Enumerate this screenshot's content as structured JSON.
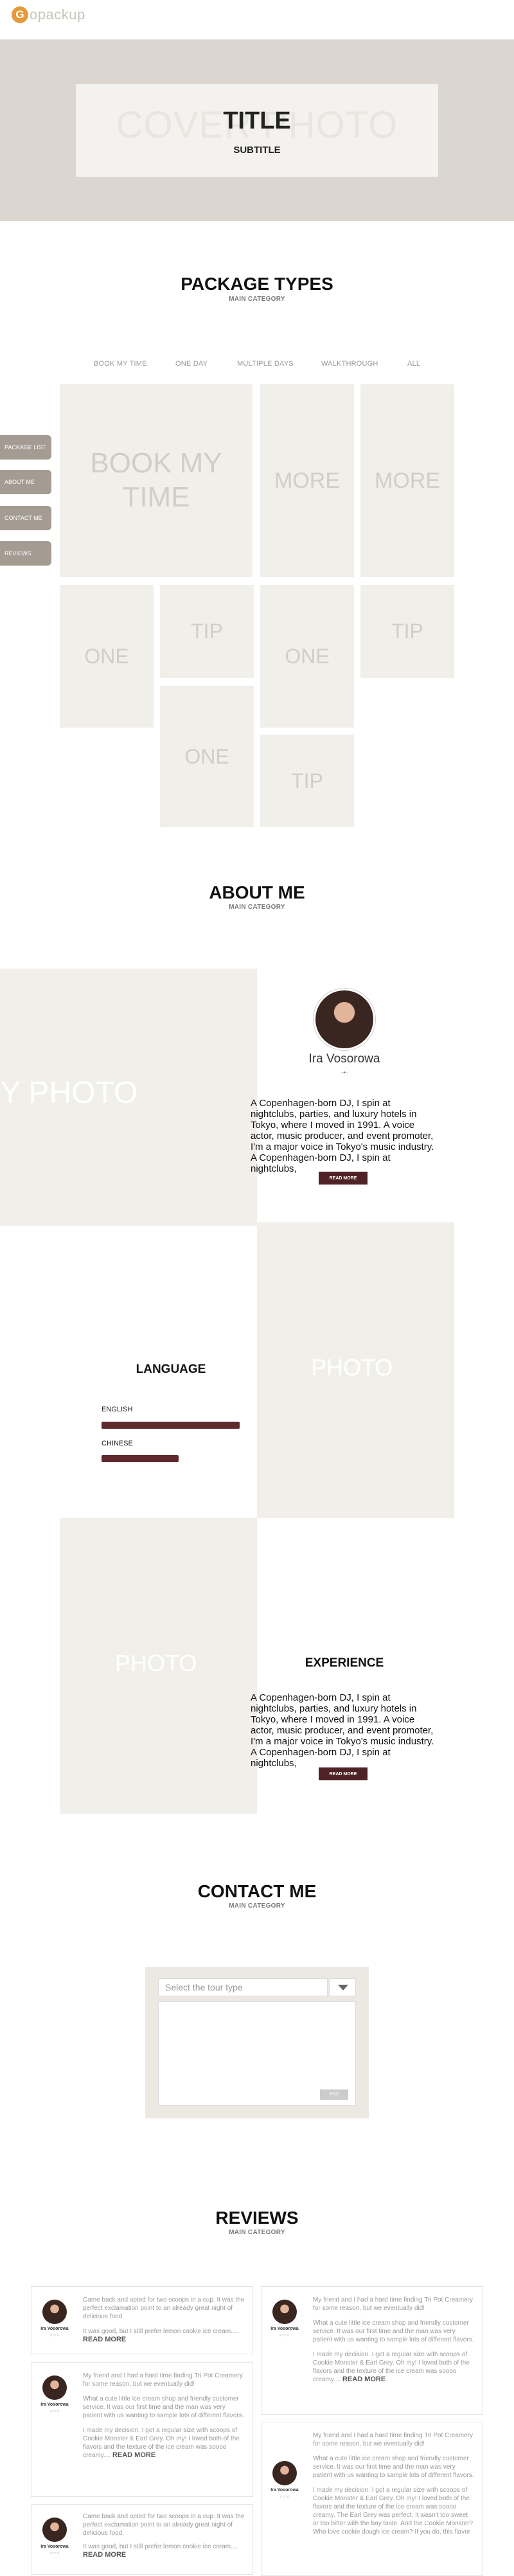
{
  "brand": {
    "name": "opackup",
    "mark": "G"
  },
  "hero": {
    "watermark": "COVER PHOTO",
    "title": "TITLE",
    "subtitle": "SUBTITLE"
  },
  "packages": {
    "title": "PACKAGE TYPES",
    "category": "MAIN CATEGORY",
    "tabs": [
      "BOOK MY TIME",
      "ONE DAY",
      "MULTIPLE DAYS",
      "WALKTHROUGH",
      "ALL"
    ],
    "side_nav": [
      "PACKAGE LIST",
      "ABOUT ME",
      "CONTACT ME",
      "REVIEWS"
    ],
    "tiles": [
      "BOOK MY TIME",
      "MORE",
      "MORE",
      "ONE",
      "TIP",
      "ONE",
      "TIP",
      "ONE",
      "TIP"
    ]
  },
  "about": {
    "title": "ABOUT ME",
    "category": "MAIN CATEGORY",
    "photo_watermark": "MY PHOTO",
    "name": "Ira Vosorowa",
    "divider": "-•-",
    "bio": "A Copenhagen-born DJ, I spin at nightclubs, parties, and luxury hotels in Tokyo, where I moved in 1991. A voice actor, music producer, and event promoter, I'm a major voice in Tokyo's music industry. A Copenhagen-born DJ, I spin at nightclubs,",
    "read_more": "READ MORE"
  },
  "language": {
    "title": "LANGUAGE",
    "photo_watermark": "PHOTO",
    "items": [
      {
        "label": "ENGLISH",
        "level": 0.85
      },
      {
        "label": "CHINESE",
        "level": 0.45
      }
    ]
  },
  "experience": {
    "title": "EXPERIENCE",
    "photo_watermark": "PHOTO",
    "text": "A Copenhagen-born DJ, I spin at nightclubs, parties, and luxury hotels in Tokyo, where I moved in 1991. A voice actor, music producer, and event promoter, I'm a major voice in Tokyo's music industry. A Copenhagen-born DJ, I spin at nightclubs,",
    "read_more": "READ MORE"
  },
  "contact": {
    "title": "CONTACT ME",
    "category": "MAIN CATEGORY",
    "select_placeholder": "Select the tour type",
    "send_label": "SEND"
  },
  "reviews": {
    "title": "REVIEWS",
    "category": "MAIN CATEGORY",
    "more_label": "READ MORE",
    "reviewer": "Ira Vosorowa",
    "stars": "☆☆☆",
    "left": [
      {
        "paras": [
          "Came back and opted for two scoops in a cup. It was the perfect exclamation point to an already great night of delicious food.",
          "It was good, but I still prefer lemon cookie ice cream...."
        ]
      },
      {
        "paras": [
          "My friend and I had a hard time finding Tri Pot Creamery for some reason, but we eventually did!",
          "What a cute little ice cream shop and friendly customer service. It was our first time and the man was very patient with us wanting to sample lots of different flavors.",
          "I made my decision. I got a regular size with scoops of Cookie Monster & Earl Grey. Oh my! I loved both of the flavors and the texture of the ice cream was soooo creamy...."
        ]
      },
      {
        "paras": [
          "Came back and opted for two scoops in a cup. It was the perfect exclamation point to an already great night of delicious food.",
          "It was good, but I still prefer lemon cookie ice cream...."
        ]
      }
    ],
    "right": [
      {
        "paras": [
          "My friend and I had a hard time finding Tri Pot Creamery for some reason, but we eventually did!",
          "What a cute little ice cream shop and friendly customer service. It was our first time and the man was very patient with us wanting to sample lots of different flavors.",
          "I made my decision. I got a regular size with scoops of Cookie Monster & Earl Grey. Oh my! I loved both of the flavors and the texture of the ice cream was soooo creamy...."
        ]
      },
      {
        "paras": [
          "My friend and I had a hard time finding Tri Pot Creamery for some reason, but we eventually did!",
          "What a cute little ice cream shop and friendly customer service. It was our first time and the man was very patient with us wanting to sample lots of different flavors.",
          "I made my decision. I got a regular size with scoops of Cookie Monster & Earl Grey. Oh my! I loved both of the flavors and the texture of the ice cream was soooo creamy. The Earl Grey was perfect. It wasn't too sweet or too bitter with the bay taste. And the Cookie Monster? Who love cookie dough ice cream? If you do, this flavor"
        ]
      }
    ]
  }
}
